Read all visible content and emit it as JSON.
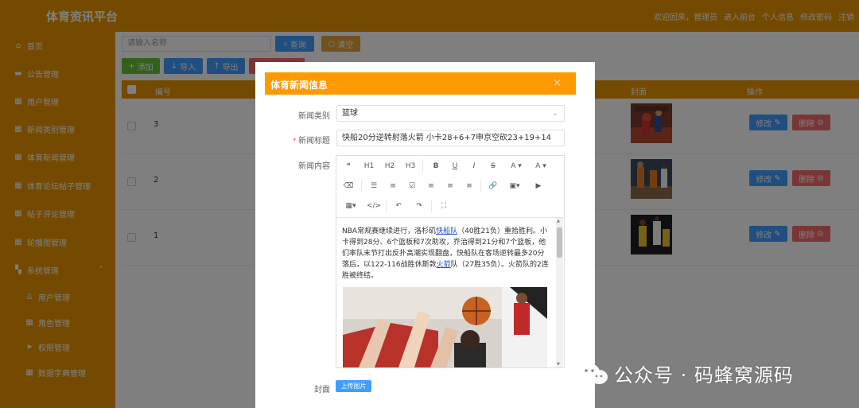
{
  "header": {
    "brand": "体育资讯平台",
    "links": [
      "欢迎回来，管理员",
      "进入前台",
      "个人信息",
      "修改密码",
      "注销"
    ]
  },
  "sidebar": {
    "items": [
      {
        "label": "首页",
        "icon": "home-icon"
      },
      {
        "label": "公告管理",
        "icon": "notice-icon"
      },
      {
        "label": "用户管理",
        "icon": "grid-icon"
      },
      {
        "label": "新闻类别管理",
        "icon": "grid-icon"
      },
      {
        "label": "体育新闻管理",
        "icon": "grid-icon"
      },
      {
        "label": "体育论坛帖子管理",
        "icon": "grid-icon"
      },
      {
        "label": "帖子评论管理",
        "icon": "grid-icon"
      },
      {
        "label": "轮播图管理",
        "icon": "grid-icon"
      },
      {
        "label": "系统管理",
        "icon": "apps-icon"
      }
    ],
    "sub_items": [
      {
        "label": "用户管理",
        "icon": "user-icon"
      },
      {
        "label": "角色管理",
        "icon": "grid-icon"
      },
      {
        "label": "权限管理",
        "icon": "send-icon"
      },
      {
        "label": "数据字典管理",
        "icon": "grid-icon"
      }
    ]
  },
  "toolbar": {
    "search_placeholder": "请输入名称",
    "search_label": "查询",
    "reset_label": "清空",
    "add_label": "添加",
    "import_label": "导入",
    "export_label": "导出"
  },
  "table": {
    "headers": {
      "id": "编号",
      "cover": "封面",
      "actions": "操作"
    },
    "rows": [
      {
        "id": "3"
      },
      {
        "id": "2"
      },
      {
        "id": "1"
      }
    ],
    "edit_label": "修改",
    "delete_label": "删除"
  },
  "dialog": {
    "title": "体育新闻信息",
    "close": "×",
    "category_label": "新闻类别",
    "category_value": "篮球",
    "title_label": "新闻标题",
    "title_value": "快船20分逆转射落火箭 小卡28+6+7申京空砍23+19+14",
    "content_label": "新闻内容",
    "content": {
      "p1": "NBA常规赛继续进行，洛杉矶",
      "link1": "快船队",
      "p2": "（40胜21负）重拾胜利。小卡得到28分、6个篮板和7次助攻，乔治得到21分和7个篮板，他们率队末节打出反扑高潮实现翻盘，快船队在客场逆转最多20分落后，以122-116战胜休斯敦",
      "link2": "火箭",
      "p3": "队（27胜35负）。火箭队的2连胜被终结。"
    },
    "cover_label": "封面",
    "upload_label": "上传图片",
    "toolbar_items": [
      "❝",
      "H1",
      "H2",
      "H3",
      "B",
      "U",
      "I",
      "S",
      "A ▾",
      "A ▾"
    ]
  },
  "watermark": {
    "text": "公众号 · 码蜂窝源码"
  },
  "colors": {
    "accent": "#e69500",
    "dialog_header": "#ff9900",
    "primary": "#409eff",
    "danger": "#f56c6c",
    "success": "#67c23a",
    "warning": "#e6a23c"
  }
}
